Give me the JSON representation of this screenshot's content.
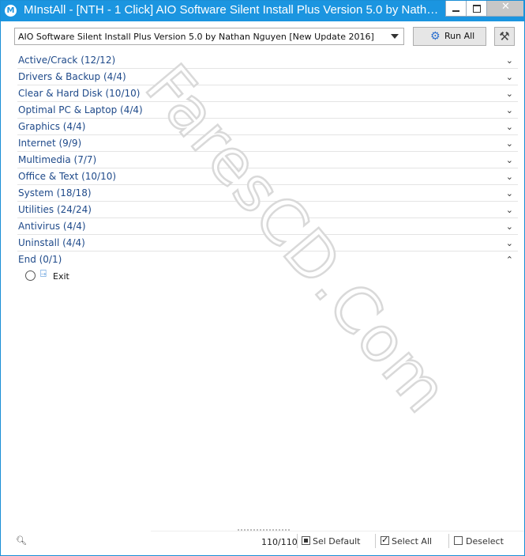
{
  "window": {
    "title": "MInstAll - [NTH - 1 Click] AIO Software Silent Install Plus Version 5.0 by Nathan...",
    "app_icon_letter": "M",
    "close_glyph": "✕"
  },
  "toolbar": {
    "package_value": "AIO Software Silent Install Plus Version 5.0 by Nathan Nguyen [New Update 2016]",
    "run_label": "Run All",
    "tools_icon": "tools-icon"
  },
  "groups": [
    {
      "label": "Active/Crack  (12/12)",
      "expanded": false
    },
    {
      "label": "Drivers & Backup  (4/4)",
      "expanded": false
    },
    {
      "label": "Clear & Hard Disk  (10/10)",
      "expanded": false
    },
    {
      "label": "Optimal PC & Laptop  (4/4)",
      "expanded": false
    },
    {
      "label": "Graphics  (4/4)",
      "expanded": false
    },
    {
      "label": "Internet  (9/9)",
      "expanded": false
    },
    {
      "label": "Multimedia  (7/7)",
      "expanded": false
    },
    {
      "label": "Office & Text  (10/10)",
      "expanded": false
    },
    {
      "label": "System  (18/18)",
      "expanded": false
    },
    {
      "label": "Utilities  (24/24)",
      "expanded": false
    },
    {
      "label": "Antivirus  (4/4)",
      "expanded": false
    },
    {
      "label": "Uninstall  (4/4)",
      "expanded": false
    },
    {
      "label": "End  (0/1)",
      "expanded": true
    }
  ],
  "end_items": [
    {
      "label": "Exit",
      "selected": false,
      "icon": "exit-icon"
    }
  ],
  "watermark": {
    "text": "FaresCD.Com"
  },
  "status": {
    "count": "110/110",
    "sel_default": "Sel Default",
    "select_all": "Select All",
    "deselect": "Deselect"
  },
  "colors": {
    "titlebar": "#1b95e0",
    "group_text": "#1f4a8a"
  }
}
